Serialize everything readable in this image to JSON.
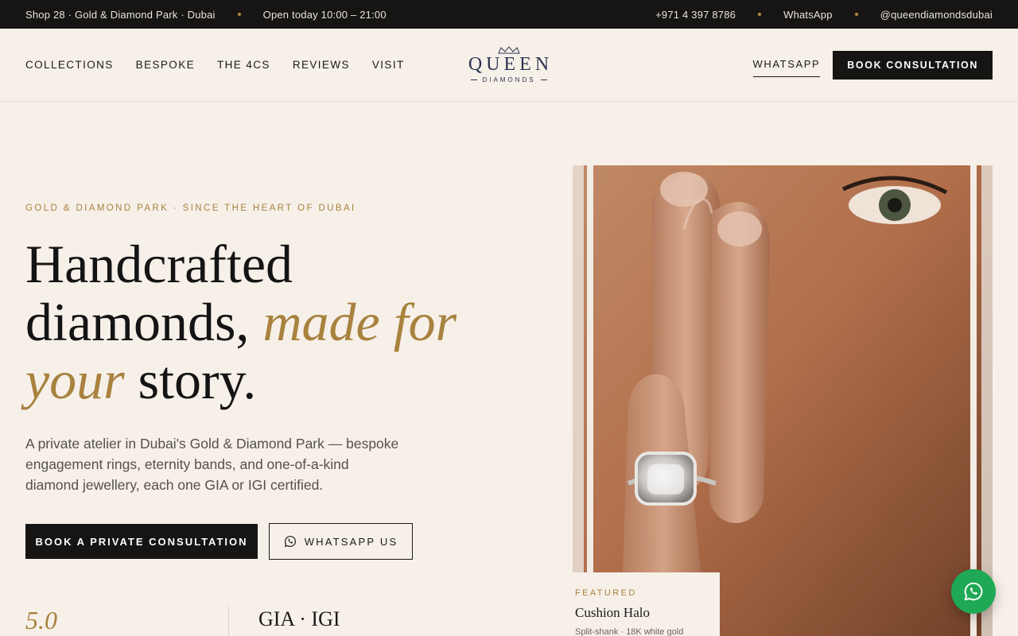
{
  "topbar": {
    "address": "Shop 28 · Gold & Diamond Park · Dubai",
    "hours": "Open today 10:00 – 21:00",
    "phone": "+971 4 397 8786",
    "whatsapp": "WhatsApp",
    "instagram": "@queendiamondsdubai"
  },
  "header": {
    "nav": [
      "COLLECTIONS",
      "BESPOKE",
      "THE 4CS",
      "REVIEWS",
      "VISIT"
    ],
    "logo_word": "QUEEN",
    "logo_sub": "DIAMONDS",
    "whatsapp_link": "WHATSAPP",
    "book_button": "BOOK CONSULTATION"
  },
  "hero": {
    "eyebrow": "GOLD & DIAMOND PARK · SINCE THE HEART OF DUBAI",
    "headline_1": "Handcrafted",
    "headline_2": "diamonds, ",
    "headline_em1": "made for",
    "headline_em2": "your",
    "headline_3": " story.",
    "lede": "A private atelier in Dubai's Gold & Diamond Park — bespoke engagement rings, eternity bands, and one-of-a-kind diamond jewellery, each one GIA or IGI certified.",
    "cta_primary": "BOOK A PRIVATE CONSULTATION",
    "cta_secondary": "WHATSAPP US",
    "stat_rating": "5.0",
    "stat_cert": "GIA · IGI"
  },
  "featured": {
    "label": "FEATURED",
    "name": "Cushion Halo",
    "desc": "Split-shank · 18K white gold"
  },
  "colors": {
    "accent": "#a8823e",
    "dark": "#161514",
    "background": "#f6f0e9",
    "whatsapp_green": "#1fa855"
  },
  "icons": {
    "whatsapp": "whatsapp-icon",
    "crown": "crown-icon"
  }
}
